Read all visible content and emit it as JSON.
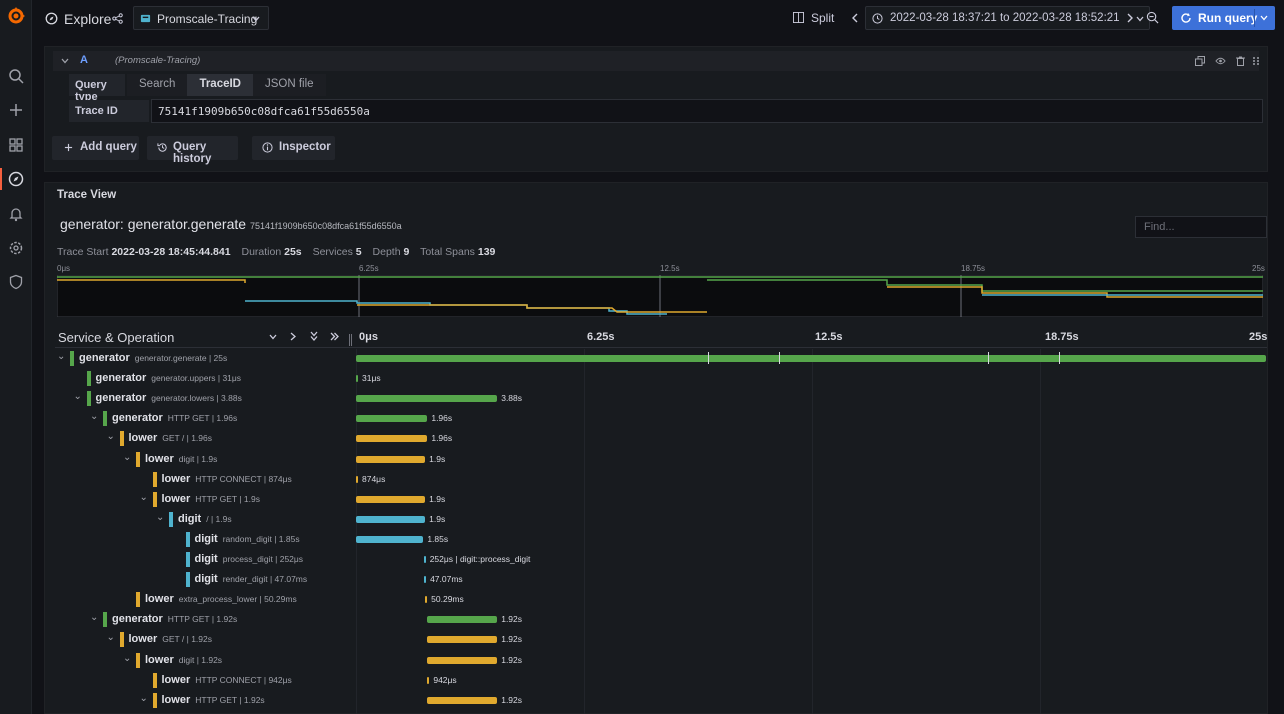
{
  "topbar": {
    "title": "Explore",
    "datasource": "Promscale-Tracing",
    "split_label": "Split",
    "time_range": "2022-03-28 18:37:21 to 2022-03-28 18:52:21",
    "run_query_label": "Run query"
  },
  "query": {
    "ref_id": "A",
    "datasource_hint": "(Promscale-Tracing)",
    "query_type_label": "Query type",
    "query_types": [
      "Search",
      "TraceID",
      "JSON file"
    ],
    "active_query_type": "TraceID",
    "trace_id_label": "Trace ID",
    "trace_id_value": "75141f1909b650c08dfca61f55d6550a",
    "add_query_label": "Add query",
    "query_history_label": "Query history",
    "inspector_label": "Inspector"
  },
  "trace": {
    "panel_title": "Trace View",
    "name": "generator: generator.generate",
    "id": "75141f1909b650c08dfca61f55d6550a",
    "find_placeholder": "Find...",
    "meta": {
      "trace_start_label": "Trace Start",
      "trace_start": "2022-03-28 18:45:44.841",
      "duration_label": "Duration",
      "duration": "25s",
      "services_label": "Services",
      "services": "5",
      "depth_label": "Depth",
      "depth": "9",
      "total_spans_label": "Total Spans",
      "total_spans": "139"
    },
    "minimap_ticks": [
      "0μs",
      "6.25s",
      "12.5s",
      "18.75s",
      "25s"
    ],
    "header": {
      "service_operation": "Service & Operation",
      "ticks": [
        "0μs",
        "6.25s",
        "12.5s",
        "18.75s",
        "25s"
      ]
    },
    "colors": {
      "generator": "#56a64b",
      "lower": "#e0a92e",
      "digit": "#4fb3ce"
    },
    "spans": [
      {
        "service": "generator",
        "operation": "generator.generate | 25s",
        "depth": 0,
        "expanded": true,
        "start": 0,
        "dur": 25,
        "label": ""
      },
      {
        "service": "generator",
        "operation": "generator.uppers | 31μs",
        "depth": 1,
        "expanded": null,
        "start": 0,
        "dur": 3e-05,
        "label": "31μs"
      },
      {
        "service": "generator",
        "operation": "generator.lowers | 3.88s",
        "depth": 1,
        "expanded": true,
        "start": 0,
        "dur": 3.88,
        "label": "3.88s"
      },
      {
        "service": "generator",
        "operation": "HTTP GET | 1.96s",
        "depth": 2,
        "expanded": true,
        "start": 0,
        "dur": 1.96,
        "label": "1.96s"
      },
      {
        "service": "lower",
        "operation": "GET / | 1.96s",
        "depth": 3,
        "expanded": true,
        "start": 0,
        "dur": 1.96,
        "label": "1.96s"
      },
      {
        "service": "lower",
        "operation": "digit | 1.9s",
        "depth": 4,
        "expanded": true,
        "start": 0,
        "dur": 1.9,
        "label": "1.9s"
      },
      {
        "service": "lower",
        "operation": "HTTP CONNECT | 874μs",
        "depth": 5,
        "expanded": null,
        "start": 0,
        "dur": 0.0009,
        "label": "874μs"
      },
      {
        "service": "lower",
        "operation": "HTTP GET | 1.9s",
        "depth": 5,
        "expanded": true,
        "start": 0,
        "dur": 1.9,
        "label": "1.9s"
      },
      {
        "service": "digit",
        "operation": "/ | 1.9s",
        "depth": 6,
        "expanded": true,
        "start": 0,
        "dur": 1.9,
        "label": "1.9s"
      },
      {
        "service": "digit",
        "operation": "random_digit | 1.85s",
        "depth": 7,
        "expanded": null,
        "start": 0,
        "dur": 1.85,
        "label": "1.85s"
      },
      {
        "service": "digit",
        "operation": "process_digit | 252μs",
        "depth": 7,
        "expanded": null,
        "start": 1.86,
        "dur": 0.0003,
        "label": "252μs | digit::process_digit"
      },
      {
        "service": "digit",
        "operation": "render_digit | 47.07ms",
        "depth": 7,
        "expanded": null,
        "start": 1.87,
        "dur": 0.047,
        "label": "47.07ms"
      },
      {
        "service": "lower",
        "operation": "extra_process_lower | 50.29ms",
        "depth": 4,
        "expanded": null,
        "start": 1.9,
        "dur": 0.05,
        "label": "50.29ms"
      },
      {
        "service": "generator",
        "operation": "HTTP GET | 1.92s",
        "depth": 2,
        "expanded": true,
        "start": 1.96,
        "dur": 1.92,
        "label": "1.92s"
      },
      {
        "service": "lower",
        "operation": "GET / | 1.92s",
        "depth": 3,
        "expanded": true,
        "start": 1.96,
        "dur": 1.92,
        "label": "1.92s"
      },
      {
        "service": "lower",
        "operation": "digit | 1.92s",
        "depth": 4,
        "expanded": true,
        "start": 1.96,
        "dur": 1.92,
        "label": "1.92s"
      },
      {
        "service": "lower",
        "operation": "HTTP CONNECT | 942μs",
        "depth": 5,
        "expanded": null,
        "start": 1.96,
        "dur": 0.001,
        "label": "942μs"
      },
      {
        "service": "lower",
        "operation": "HTTP GET | 1.92s",
        "depth": 5,
        "expanded": true,
        "start": 1.96,
        "dur": 1.92,
        "label": "1.92s"
      }
    ]
  }
}
